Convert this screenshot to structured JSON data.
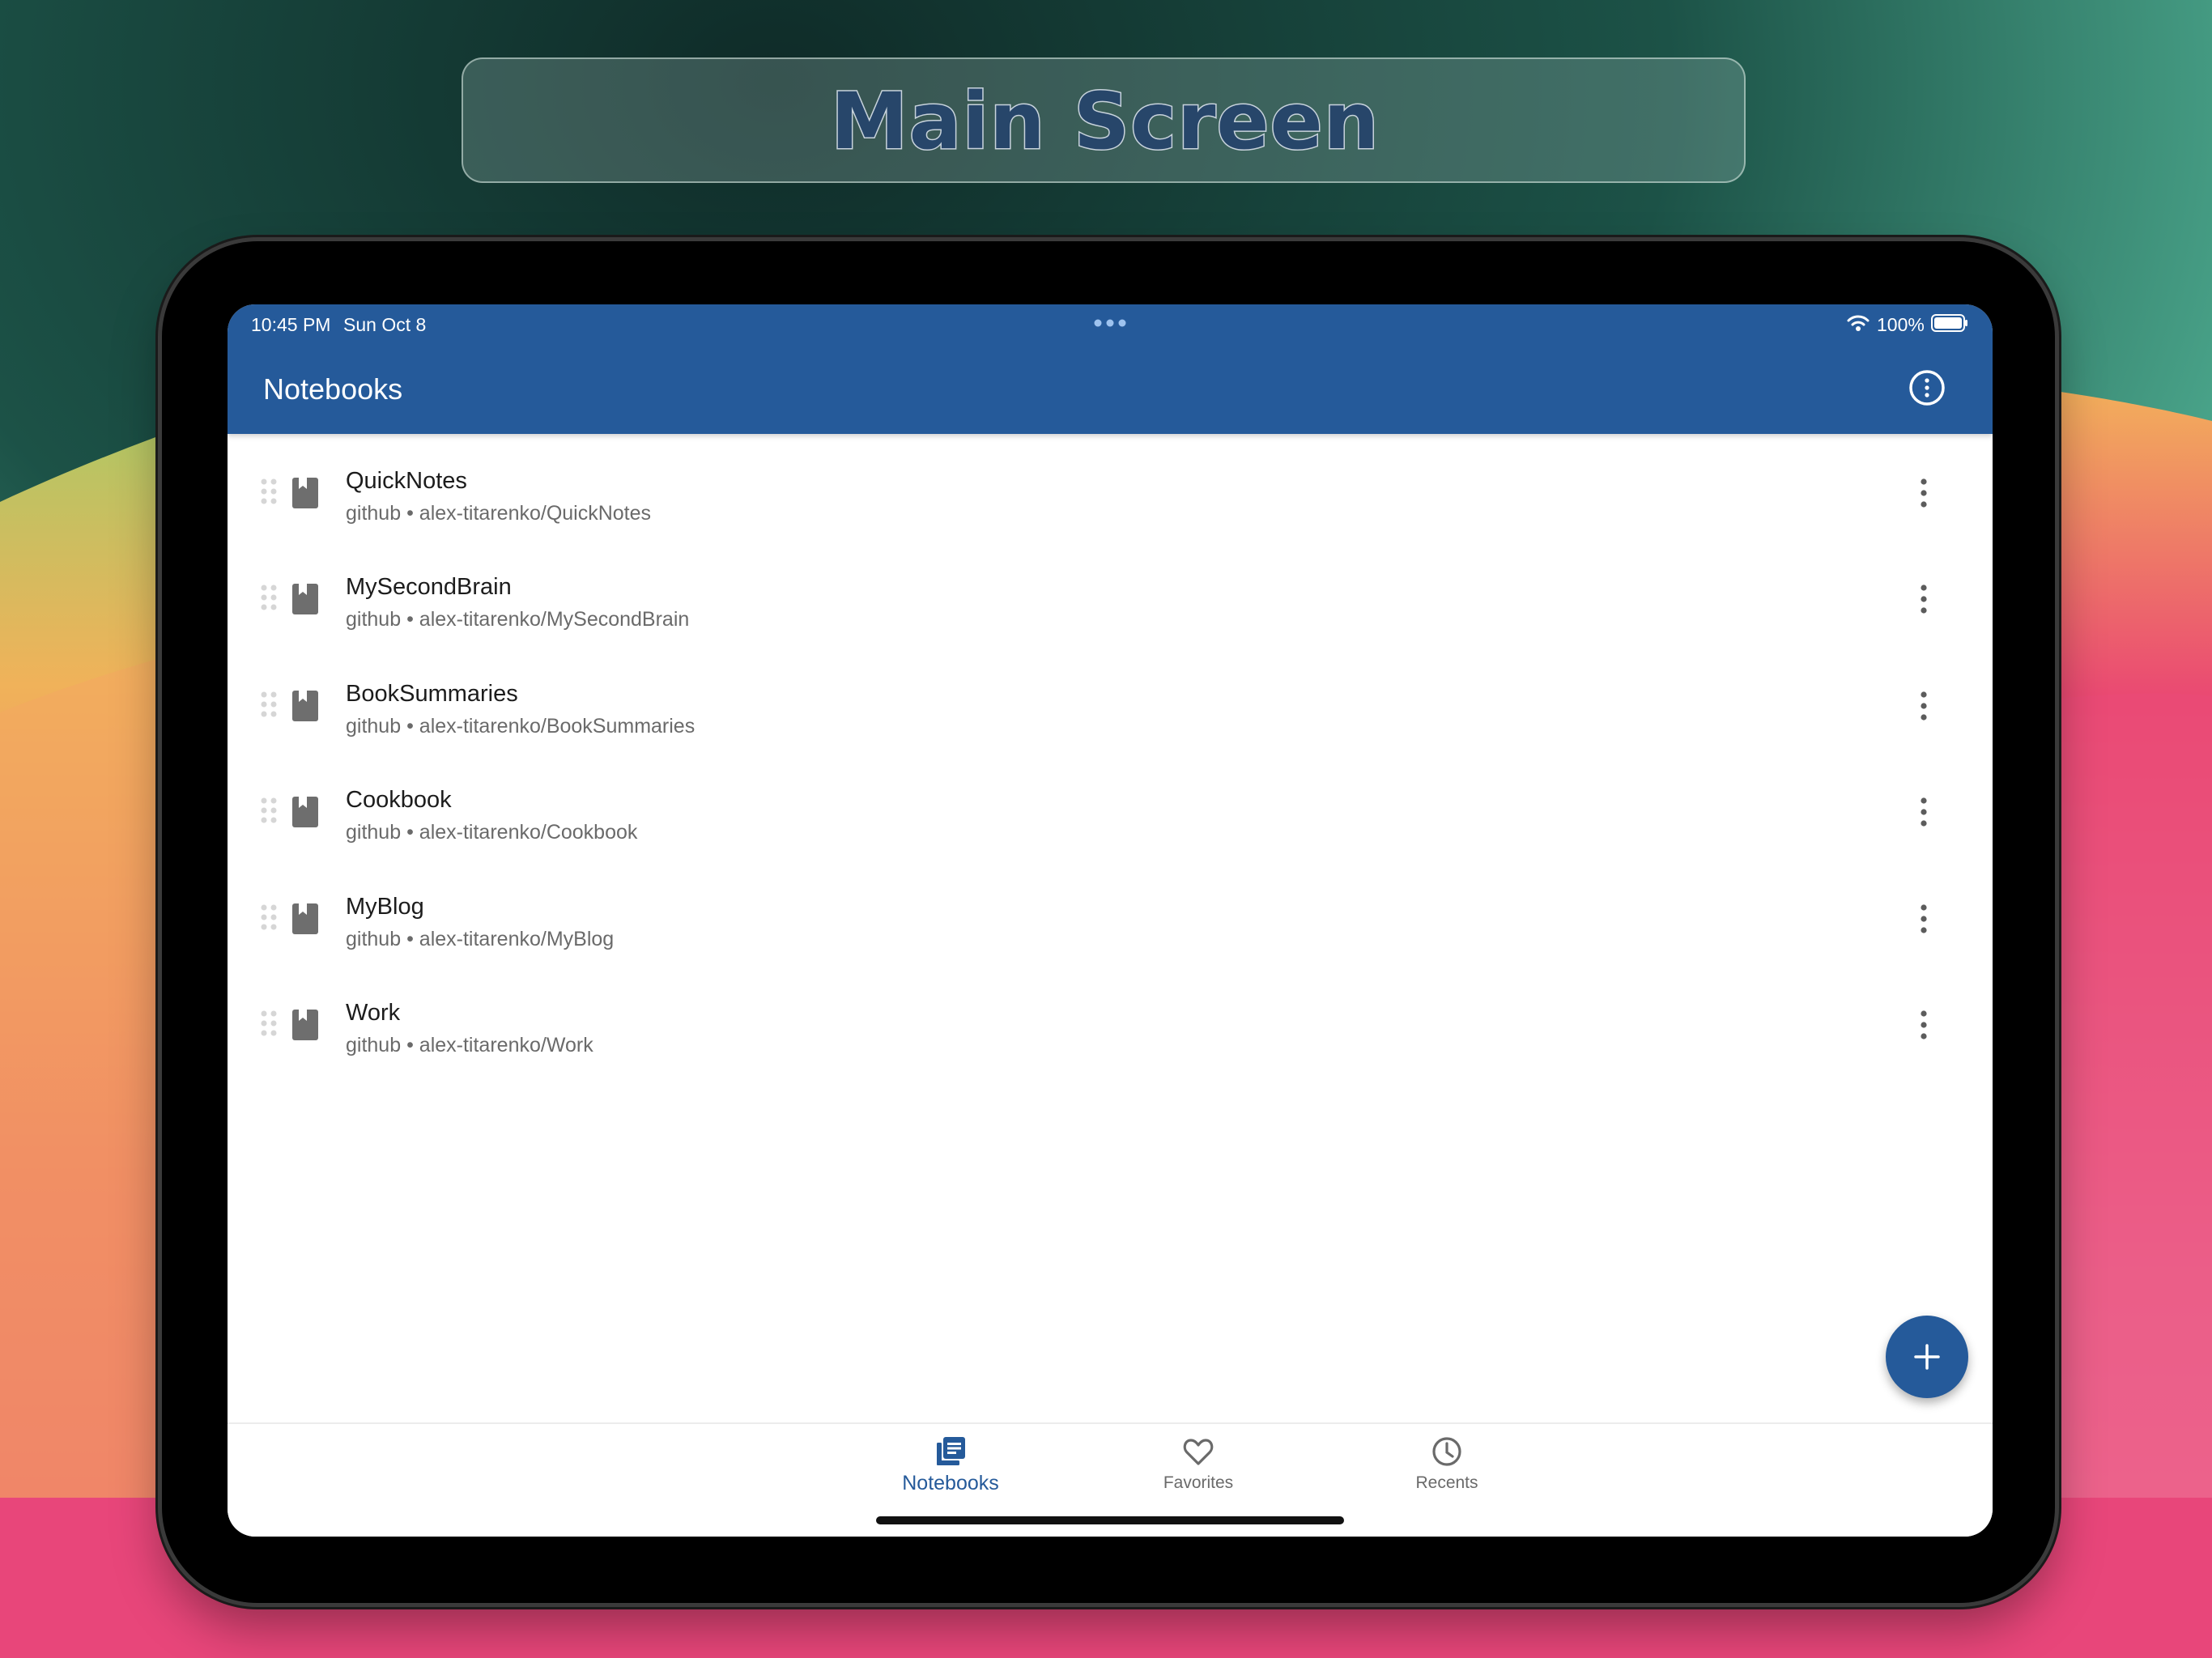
{
  "banner": {
    "title": "Main Screen"
  },
  "status_bar": {
    "time": "10:45 PM",
    "date": "Sun Oct 8",
    "battery": "100%"
  },
  "header": {
    "title": "Notebooks",
    "info_icon": "info-circle-icon"
  },
  "notebooks": [
    {
      "name": "QuickNotes",
      "source": "github",
      "separator": "•",
      "repo": "alex-titarenko/QuickNotes"
    },
    {
      "name": "MySecondBrain",
      "source": "github",
      "separator": "•",
      "repo": "alex-titarenko/MySecondBrain"
    },
    {
      "name": "BookSummaries",
      "source": "github",
      "separator": "•",
      "repo": "alex-titarenko/BookSummaries"
    },
    {
      "name": "Cookbook",
      "source": "github",
      "separator": "•",
      "repo": "alex-titarenko/Cookbook"
    },
    {
      "name": "MyBlog",
      "source": "github",
      "separator": "•",
      "repo": "alex-titarenko/MyBlog"
    },
    {
      "name": "Work",
      "source": "github",
      "separator": "•",
      "repo": "alex-titarenko/Work"
    }
  ],
  "fab": {
    "icon": "plus-icon"
  },
  "bottom_nav": {
    "items": [
      {
        "label": "Notebooks",
        "icon": "notebooks-icon",
        "active": true
      },
      {
        "label": "Favorites",
        "icon": "heart-icon",
        "active": false
      },
      {
        "label": "Recents",
        "icon": "clock-icon",
        "active": false
      }
    ]
  },
  "colors": {
    "primary": "#255a9a",
    "text_primary": "#1c1c1c",
    "text_secondary": "#6a6a6a",
    "icon_grey": "#6e6e6e"
  }
}
